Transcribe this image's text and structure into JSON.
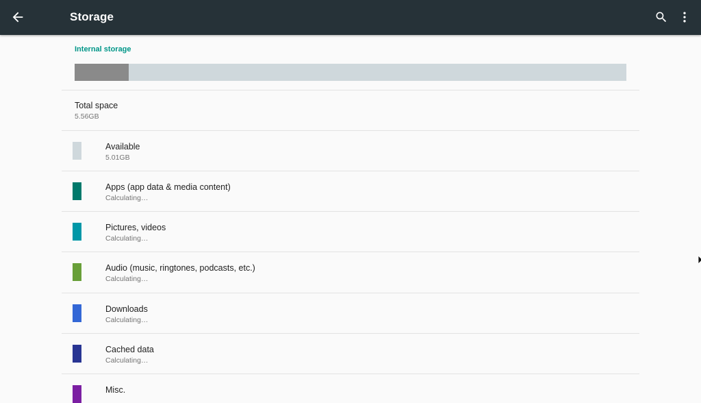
{
  "appbar": {
    "title": "Storage",
    "back_icon": "arrow-back-icon",
    "search_icon": "search-icon",
    "more_icon": "more-vert-icon",
    "color": "#263238"
  },
  "storage": {
    "section_header": "Internal storage",
    "used_fraction": 0.098,
    "used_color": "#8a8a8a",
    "free_color": "#cfd8dc",
    "total": {
      "title": "Total space",
      "value": "5.56GB"
    },
    "categories": [
      {
        "title": "Available",
        "summary": "5.01GB",
        "color": "#cfd8dc"
      },
      {
        "title": "Apps (app data & media content)",
        "summary": "Calculating…",
        "color": "#00796b"
      },
      {
        "title": "Pictures, videos",
        "summary": "Calculating…",
        "color": "#0097a7"
      },
      {
        "title": "Audio (music, ringtones, podcasts, etc.)",
        "summary": "Calculating…",
        "color": "#689f38"
      },
      {
        "title": "Downloads",
        "summary": "Calculating…",
        "color": "#3367d6"
      },
      {
        "title": "Cached data",
        "summary": "Calculating…",
        "color": "#283593"
      },
      {
        "title": "Misc.",
        "summary": "",
        "color": "#7b1fa2"
      }
    ]
  }
}
